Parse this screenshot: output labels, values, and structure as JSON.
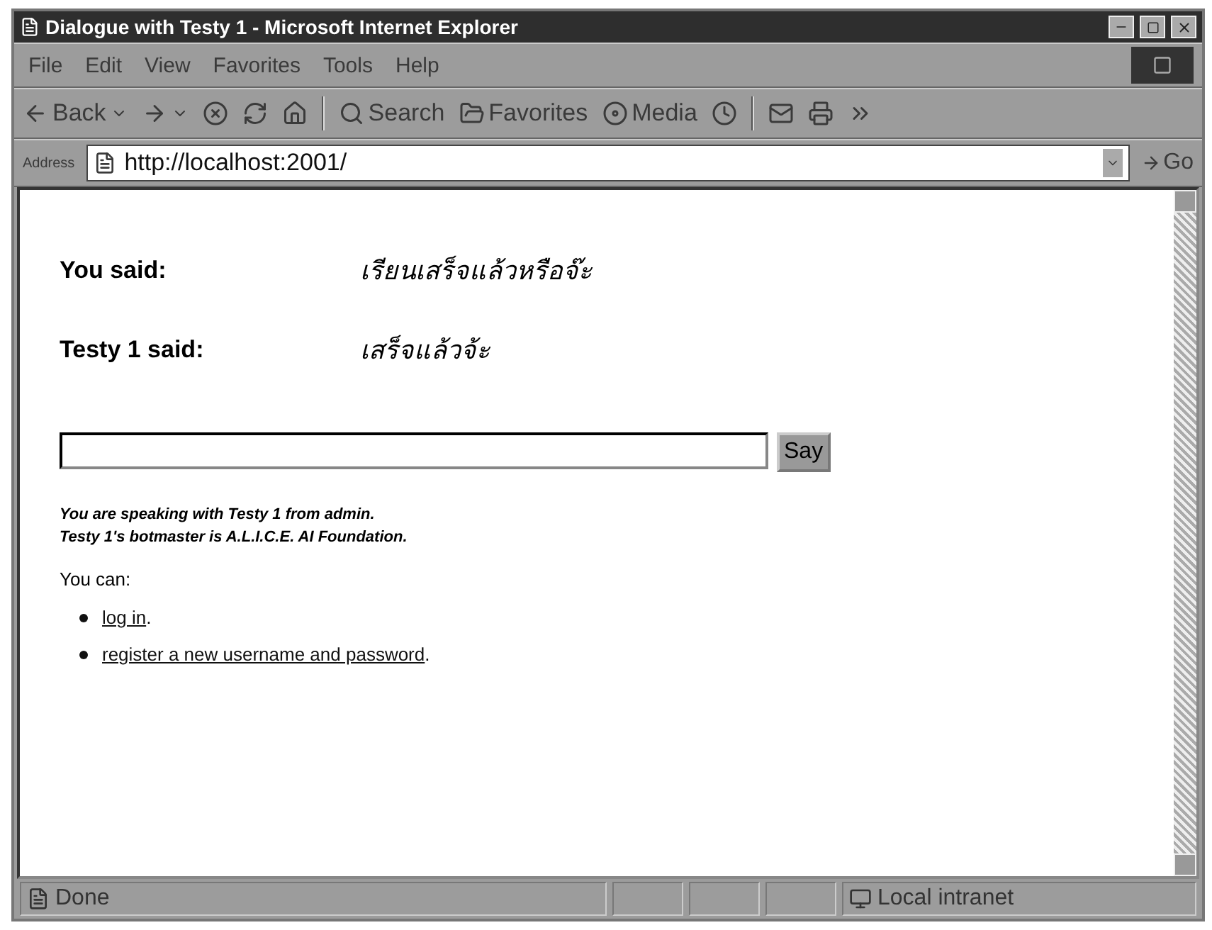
{
  "window": {
    "title": "Dialogue with Testy 1 - Microsoft Internet Explorer"
  },
  "menu": [
    "File",
    "Edit",
    "View",
    "Favorites",
    "Tools",
    "Help"
  ],
  "toolbar": [
    {
      "kind": "back",
      "label": "Back"
    },
    {
      "kind": "forward"
    },
    {
      "kind": "stop"
    },
    {
      "kind": "refresh"
    },
    {
      "kind": "home"
    },
    {
      "kind": "separator"
    },
    {
      "kind": "search",
      "label": "Search"
    },
    {
      "kind": "favorites",
      "label": "Favorites"
    },
    {
      "kind": "media",
      "label": "Media"
    },
    {
      "kind": "history"
    },
    {
      "kind": "separator"
    },
    {
      "kind": "mail"
    },
    {
      "kind": "print"
    },
    {
      "kind": "more"
    }
  ],
  "address": {
    "label": "Address",
    "url": "http://localhost:2001/",
    "go": "Go"
  },
  "page": {
    "dialogue": [
      {
        "speaker": "You said:",
        "text": "เรียนเสร็จแล้วหรือจ๊ะ"
      },
      {
        "speaker": "Testy 1 said:",
        "text": "เสร็จแล้วจ้ะ"
      }
    ],
    "say_button": "Say",
    "info": [
      "You are speaking with Testy 1 from admin.",
      "Testy 1's botmaster is A.L.I.C.E. AI Foundation."
    ],
    "you_can": "You can:",
    "options": [
      {
        "link": "log in",
        "suffix": "."
      },
      {
        "link": "register a new username and password",
        "suffix": "."
      }
    ]
  },
  "status_bar": {
    "status": "Done",
    "zone": "Local intranet"
  }
}
